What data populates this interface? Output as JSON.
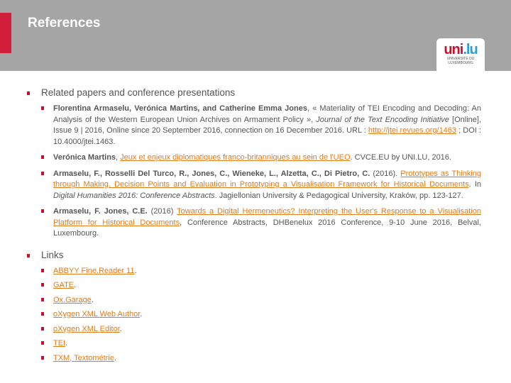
{
  "header": {
    "title": "References",
    "logo_text": "uni.lu",
    "logo_sub1": "UNIVERSITÉ DU",
    "logo_sub2": "LUXEMBOURG"
  },
  "sections": [
    {
      "heading": "Related papers and conference presentations"
    },
    {
      "heading": "Links"
    }
  ],
  "refs": [
    {
      "authors": "Florentina Armaselu, Verónica Martins, and Catherine Emma Jones",
      "t1": ", « Materiality of TEI Encoding and Decoding: An Analysis of the Western European Union Archives on Armament Policy », ",
      "journal": "Journal of the Text Encoding Initiative",
      "t2": " [Online], Issue 9 | 2016, Online since 20 September 2016, connection on 16 December 2016. URL : ",
      "link": "http://jtei.revues.org/1463",
      "t3": " ; DOI : 10.4000/jtei.1463."
    },
    {
      "authors": "Verónica Martins",
      "t1": ", ",
      "link": "Jeux et enjeux diplomatiques franco-britanniques au sein de l'UEO",
      "t2": ". CVCE.EU by UNI.LU, 2016."
    },
    {
      "authors": "Armaselu, F., Rosselli Del Turco, R., Jones, C., Wieneke, L., Alzetta, C., Di Pietro, C.",
      "t1": " (2016). ",
      "link": "Prototypes as Thinking through Making. Decision Points and Evaluation in Prototyping a Visualisation Framework for Historical Documents",
      "t2": ". In ",
      "journal": "Digital Humanities 2016: Conference Abstracts",
      "t3": ". Jagiellonian University & Pedagogical University, Kraków, pp. 123-127."
    },
    {
      "authors": "Armaselu, F. Jones, C.E.",
      "t1": " (2016) ",
      "link": "Towards a Digital Hermeneutics? Interpreting the User's Response to a Visualisation Platform for Historical Documents",
      "t2": ", Conference Abstracts, DHBenelux 2016 Conference, 9-10 June 2016, Belval, Luxembourg."
    }
  ],
  "links": [
    "ABBYY Fine.Reader 11",
    "GATE",
    "Ox.Garage",
    "oXygen XML Web Author",
    "oXygen XML Editor",
    "TEI",
    "TXM, Textométrie"
  ],
  "colors": {
    "accent": "#c8102e",
    "header": "#a5a5a5",
    "link": "#e07b1a"
  }
}
